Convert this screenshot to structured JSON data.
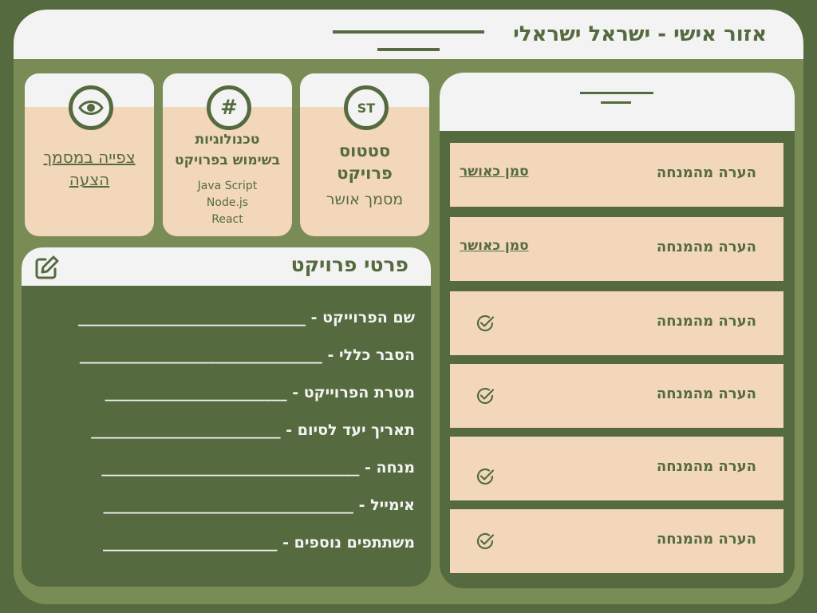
{
  "header": {
    "title": "אזור אישי - ישראל ישראלי"
  },
  "cards": {
    "status": {
      "icon_text": "ST",
      "icon": "status-icon",
      "title_line1": "סטטוס",
      "title_line2": "פרויקט",
      "value": "מסמך אושר"
    },
    "technologies": {
      "icon_text": "#",
      "icon": "hash-icon",
      "title_line1": "טכנולוגיות",
      "title_line2": "בשימוש בפרויקט",
      "items": [
        "Java Script",
        "Node.js",
        "React"
      ]
    },
    "view": {
      "icon": "eye-icon",
      "link_line1": "צפייה במסמך",
      "link_line2": "הצעה"
    }
  },
  "details": {
    "title": "פרטי פרויקט",
    "edit_icon": "edit-icon",
    "fields": [
      "שם הפרוייקט - ______________________________",
      "הסבר כללי - ________________________________",
      "מטרת הפרוייקט - ________________________",
      "תאריך יעד לסיום - _________________________",
      "מנחה - __________________________________",
      "אימייל - _________________________________",
      "משתתפים נוספים - _______________________"
    ]
  },
  "notes": {
    "items": [
      {
        "label": "הערה מהמנחה",
        "action": "סמן כאושר",
        "done": false
      },
      {
        "label": "הערה מהמנחה",
        "action": "סמן כאושר",
        "done": false
      },
      {
        "label": "הערה מהמנחה",
        "done": true
      },
      {
        "label": "הערה מהמנחה",
        "done": true
      },
      {
        "label": "הערה מהמנחה",
        "done": true
      },
      {
        "label": "הערה מהמנחה",
        "done": true
      }
    ]
  },
  "colors": {
    "dark_green": "#556b3f",
    "mid_green": "#7a8c55",
    "light": "#f3f3f3",
    "peach": "#f2d7bb"
  }
}
